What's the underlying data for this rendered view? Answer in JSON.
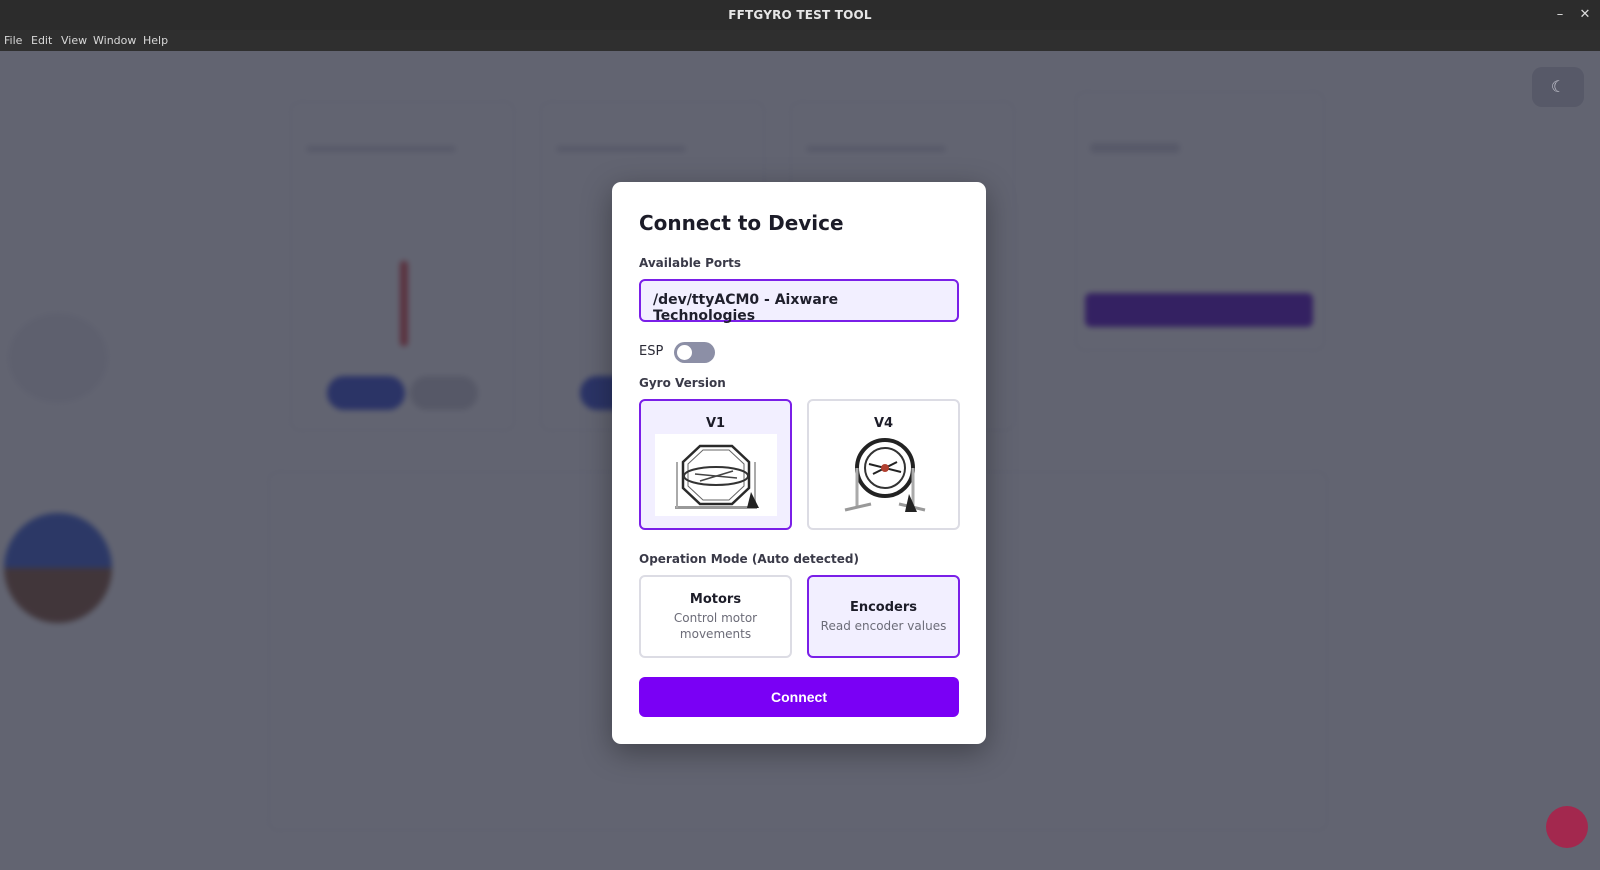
{
  "window": {
    "title": "FFTGYRO TEST TOOL",
    "minimize_icon": "minimize-icon",
    "close_icon": "close-icon"
  },
  "menu": [
    "File",
    "Edit",
    "View",
    "Window",
    "Help"
  ],
  "theme_toggle_icon": "moon-icon",
  "modal": {
    "title": "Connect to Device",
    "ports_label": "Available Ports",
    "selected_port": "/dev/ttyACM0 - Aixware Technologies",
    "esp_label": "ESP",
    "esp_enabled": false,
    "gyro_label": "Gyro Version",
    "gyro_versions": [
      {
        "label": "V1",
        "selected": true
      },
      {
        "label": "V4",
        "selected": false
      }
    ],
    "mode_label": "Operation Mode (Auto detected)",
    "modes": [
      {
        "title": "Motors",
        "desc": "Control motor movements",
        "selected": false
      },
      {
        "title": "Encoders",
        "desc": "Read encoder values",
        "selected": true
      }
    ],
    "connect_label": "Connect"
  },
  "colors": {
    "accent": "#7a00f5",
    "selected_border": "#7a1fe8",
    "selected_bg": "#f2efff"
  }
}
